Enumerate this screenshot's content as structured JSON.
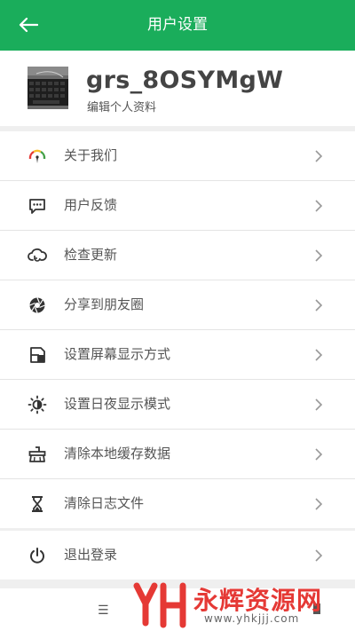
{
  "header": {
    "title": "用户设置",
    "back_icon": "arrow-left-icon",
    "color": "#1aad5b"
  },
  "profile": {
    "username": "grs_8OSYMgW",
    "subtitle": "编辑个人资料",
    "avatar": "keyboard-photo"
  },
  "menu": [
    {
      "label": "关于我们",
      "icon": "gauge-icon"
    },
    {
      "label": "用户反馈",
      "icon": "chat-bubble-icon"
    },
    {
      "label": "检查更新",
      "icon": "cloud-refresh-icon"
    },
    {
      "label": "分享到朋友圈",
      "icon": "aperture-icon"
    },
    {
      "label": "设置屏幕显示方式",
      "icon": "screen-mode-icon"
    },
    {
      "label": "设置日夜显示模式",
      "icon": "sun-icon"
    },
    {
      "label": "清除本地缓存数据",
      "icon": "broom-icon"
    },
    {
      "label": "清除日志文件",
      "icon": "hourglass-icon"
    }
  ],
  "logout": {
    "label": "退出登录",
    "icon": "power-icon"
  },
  "watermark": {
    "name": "永辉资源网",
    "url": "www.yhkjjj.com"
  }
}
